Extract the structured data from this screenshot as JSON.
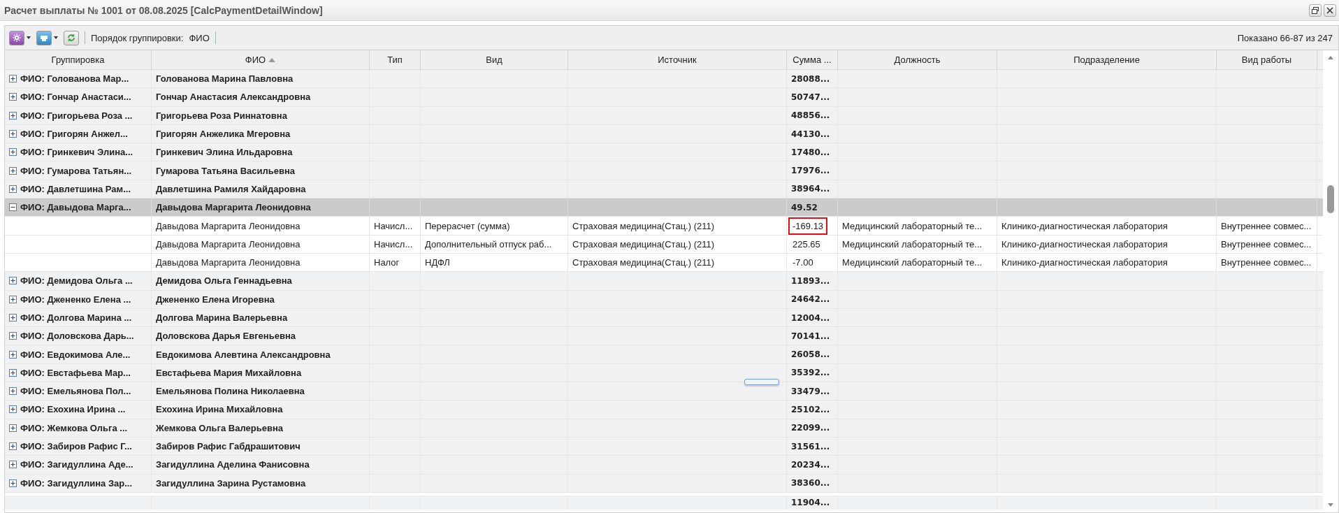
{
  "window": {
    "title": "Расчет выплаты № 1001 от 08.08.2025 [CalcPaymentDetailWindow]"
  },
  "toolbar": {
    "grouping_label": "Порядок группировки:",
    "grouping_value": "ФИО",
    "shown": "Показано 66-87 из 247"
  },
  "columns": [
    {
      "label": "Группировка",
      "sorted": false
    },
    {
      "label": "ФИО",
      "sorted": true
    },
    {
      "label": "Тип",
      "sorted": false
    },
    {
      "label": "Вид",
      "sorted": false
    },
    {
      "label": "Источник",
      "sorted": false
    },
    {
      "label": "Сумма ...",
      "sorted": false
    },
    {
      "label": "Должность",
      "sorted": false
    },
    {
      "label": "Подразделение",
      "sorted": false
    },
    {
      "label": "Вид работы",
      "sorted": false
    }
  ],
  "groups": [
    {
      "label": "ФИО: Голованова Мар...",
      "fio": "Голованова Марина Павловна",
      "sum": "28088...",
      "expanded": false,
      "selected": false
    },
    {
      "label": "ФИО: Гончар Анастаси...",
      "fio": "Гончар Анастасия Александровна",
      "sum": "50747...",
      "expanded": false,
      "selected": false
    },
    {
      "label": "ФИО: Григорьева Роза ...",
      "fio": "Григорьева Роза Риннатовна",
      "sum": "48856...",
      "expanded": false,
      "selected": false
    },
    {
      "label": "ФИО: Григорян Анжел...",
      "fio": "Григорян Анжелика Мгеровна",
      "sum": "44130...",
      "expanded": false,
      "selected": false
    },
    {
      "label": "ФИО: Гринкевич Элина...",
      "fio": "Гринкевич Элина Ильдаровна",
      "sum": "17480...",
      "expanded": false,
      "selected": false
    },
    {
      "label": "ФИО: Гумарова Татьян...",
      "fio": "Гумарова Татьяна Васильевна",
      "sum": "17976...",
      "expanded": false,
      "selected": false
    },
    {
      "label": "ФИО: Давлетшина Рам...",
      "fio": "Давлетшина Рамиля Хайдаровна",
      "sum": "38964...",
      "expanded": false,
      "selected": false
    },
    {
      "label": "ФИО: Давыдова Марга...",
      "fio": "Давыдова Маргарита Леонидовна",
      "sum": "49.52",
      "expanded": true,
      "selected": true,
      "rows": [
        {
          "fio": "Давыдова Маргарита Леонидовна",
          "type": "Начисл...",
          "kind": "Перерасчет (сумма)",
          "source": "Страховая медицина(Стац.) (211)",
          "sum": "-169.13",
          "position": "Медицинский лабораторный те...",
          "department": "Клинико-диагностическая лаборатория",
          "work_type": "Внутреннее совмес...",
          "highlighted": true
        },
        {
          "fio": "Давыдова Маргарита Леонидовна",
          "type": "Начисл...",
          "kind": "Дополнительный отпуск раб...",
          "source": "Страховая медицина(Стац.) (211)",
          "sum": "225.65",
          "position": "Медицинский лабораторный те...",
          "department": "Клинико-диагностическая лаборатория",
          "work_type": "Внутреннее совмес...",
          "highlighted": false
        },
        {
          "fio": "Давыдова Маргарита Леонидовна",
          "type": "Налог",
          "kind": "НДФЛ",
          "source": "Страховая медицина(Стац.) (211)",
          "sum": "-7.00",
          "position": "Медицинский лабораторный те...",
          "department": "Клинико-диагностическая лаборатория",
          "work_type": "Внутреннее совмес...",
          "highlighted": false
        }
      ]
    },
    {
      "label": "ФИО: Демидова Ольга ...",
      "fio": "Демидова Ольга Геннадьевна",
      "sum": "11893...",
      "expanded": false,
      "selected": false
    },
    {
      "label": "ФИО: Джененко Елена ...",
      "fio": "Джененко Елена Игоревна",
      "sum": "24642...",
      "expanded": false,
      "selected": false
    },
    {
      "label": "ФИО: Долгова Марина ...",
      "fio": "Долгова Марина Валерьевна",
      "sum": "12004...",
      "expanded": false,
      "selected": false
    },
    {
      "label": "ФИО: Доловскова Дарь...",
      "fio": "Доловскова Дарья Евгеньевна",
      "sum": "70141...",
      "expanded": false,
      "selected": false
    },
    {
      "label": "ФИО: Евдокимова Але...",
      "fio": "Евдокимова Алевтина Александровна",
      "sum": "26058...",
      "expanded": false,
      "selected": false
    },
    {
      "label": "ФИО: Евстафьева Мар...",
      "fio": "Евстафьева Мария Михайловна",
      "sum": "35392...",
      "expanded": false,
      "selected": false
    },
    {
      "label": "ФИО: Емельянова Пол...",
      "fio": "Емельянова Полина Николаевна",
      "sum": "33479...",
      "expanded": false,
      "selected": false
    },
    {
      "label": "ФИО: Ехохина Ирина ...",
      "fio": "Ехохина Ирина Михайловна",
      "sum": "25102...",
      "expanded": false,
      "selected": false
    },
    {
      "label": "ФИО: Жемкова Ольга ...",
      "fio": "Жемкова Ольга Валерьевна",
      "sum": "22099...",
      "expanded": false,
      "selected": false
    },
    {
      "label": "ФИО: Забиров Рафис Г...",
      "fio": "Забиров Рафис Габдрашитович",
      "sum": "31561...",
      "expanded": false,
      "selected": false
    },
    {
      "label": "ФИО: Загидуллина Аде...",
      "fio": "Загидуллина Аделина Фанисовна",
      "sum": "20234...",
      "expanded": false,
      "selected": false
    },
    {
      "label": "ФИО: Загидуллина Зар...",
      "fio": "Загидуллина Зарина Рустамовна",
      "sum": "38360...",
      "expanded": false,
      "selected": false
    }
  ],
  "summary": {
    "sum": "11904..."
  }
}
